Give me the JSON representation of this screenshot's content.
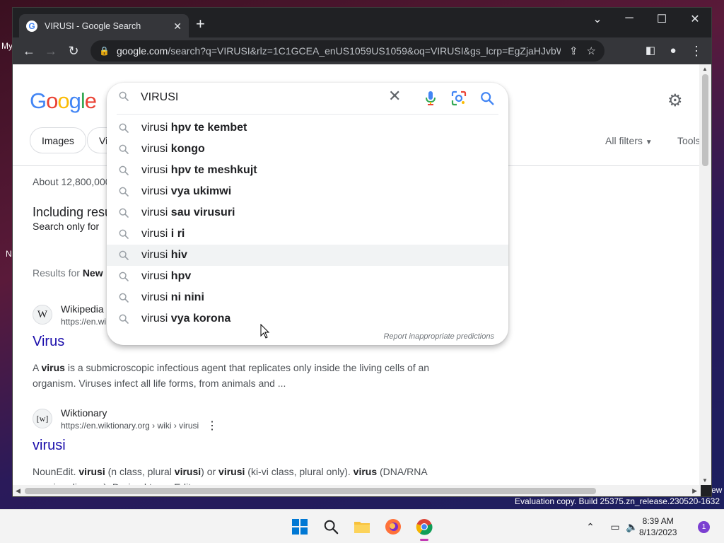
{
  "desktop": {
    "text_my": "My",
    "text_n": "N",
    "text_ew": "ew"
  },
  "browser": {
    "tab_title": "VIRUSI - Google Search",
    "new_tab": "+",
    "url_host": "google.com",
    "url_rest": "/search?q=VIRUSI&rlz=1C1GCEA_enUS1059US1059&oq=VIRUSI&gs_lcrp=EgZjaHJvbWUyBgg..."
  },
  "search": {
    "query": "VIRUSI",
    "suggestions": [
      {
        "prefix": "virusi",
        "bold": "hpv te kembet"
      },
      {
        "prefix": "virusi",
        "bold": "kongo"
      },
      {
        "prefix": "virusi",
        "bold": "hpv te meshkujt"
      },
      {
        "prefix": "virusi",
        "bold": "vya ukimwi"
      },
      {
        "prefix": "virusi",
        "bold": "sau virusuri"
      },
      {
        "prefix": "virusi",
        "bold": "i ri"
      },
      {
        "prefix": "virusi",
        "bold": "hiv"
      },
      {
        "prefix": "virusi",
        "bold": "hpv"
      },
      {
        "prefix": "virusi",
        "bold": "ni nini"
      },
      {
        "prefix": "virusi",
        "bold": "vya korona"
      }
    ],
    "hovered_index": 6,
    "report_label": "Report inappropriate predictions"
  },
  "chips": {
    "images": "Images",
    "videos_partial": "Vi",
    "all_filters": "All filters",
    "tools": "Tools"
  },
  "results": {
    "stats_partial": "About 12,800,000",
    "including_partial": "Including resu",
    "search_only_partial": "Search only for",
    "results_for_label": "Results for",
    "results_for_value": "New ",
    "items": [
      {
        "fav": "W",
        "site": "Wikipedia",
        "cite": "https://en.wi",
        "title": "Virus",
        "snippet_parts": [
          "A ",
          "virus",
          " is a submicroscopic infectious agent that replicates only inside the living cells of an organism. Viruses infect all life forms, from animals and ..."
        ]
      },
      {
        "fav": "[w]",
        "site": "Wiktionary",
        "cite": "https://en.wiktionary.org › wiki › virusi",
        "title": "virusi",
        "snippet_parts": [
          "NounEdit. ",
          "virusi",
          " (n class, plural ",
          "virusi",
          ") or ",
          "virusi",
          " (ki-vi class, plural only). ",
          "virus",
          " (DNA/RNA causing disease). Derived termsEdit."
        ]
      }
    ]
  },
  "os": {
    "watermark": "Evaluation copy. Build 25375.zn_release.230520-1632",
    "time": "8:39 AM",
    "date": "8/13/2023",
    "notification_count": "1"
  },
  "colors": {
    "google_blue": "#4285f4",
    "link": "#1a0dab",
    "chrome_dark": "#202124"
  }
}
